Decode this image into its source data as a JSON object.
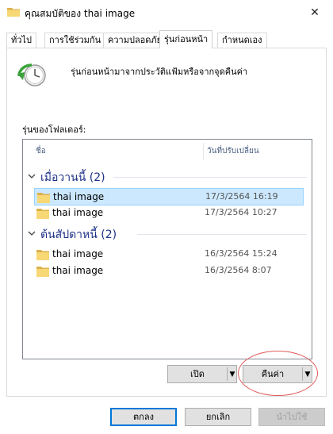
{
  "window": {
    "title": "คุณสมบัติของ thai image",
    "close_glyph": "✕"
  },
  "tabs": [
    {
      "label": "ทั่วไป",
      "active": false
    },
    {
      "label": "การใช้ร่วมกัน",
      "active": false
    },
    {
      "label": "ความปลอดภัย",
      "active": false
    },
    {
      "label": "รุ่นก่อนหน้า",
      "active": true
    },
    {
      "label": "กำหนดเอง",
      "active": false
    }
  ],
  "page": {
    "description": "รุ่นก่อนหน้ามาจากประวัติแฟ้มหรือจากจุดคืนค่า",
    "versions_label": "รุ่นของโฟลเดอร์:",
    "columns": {
      "name": "ชื่อ",
      "date": "วันที่ปรับเปลี่ยน"
    },
    "groups": [
      {
        "title": "เมื่อวานนี้ (2)",
        "rows": [
          {
            "name": "thai image",
            "date": "17/3/2564 16:19",
            "selected": true
          },
          {
            "name": "thai image",
            "date": "17/3/2564 10:27",
            "selected": false
          }
        ]
      },
      {
        "title": "ต้นสัปดาหนี้ (2)",
        "rows": [
          {
            "name": "thai image",
            "date": "16/3/2564 15:24",
            "selected": false
          },
          {
            "name": "thai image",
            "date": "16/3/2564 8:07",
            "selected": false
          }
        ]
      }
    ],
    "open_button": "เปิด",
    "restore_button": "คืนค่า"
  },
  "buttons": {
    "ok": "ตกลง",
    "cancel": "ยกเลิก",
    "apply": "นำไปใช้"
  },
  "colors": {
    "selection": "#cce8ff",
    "group_title": "#1e3287",
    "folder": "#f8d775",
    "highlight": "#e05a5a"
  },
  "icons": {
    "title": "folder-icon",
    "page": "restore-clock-icon",
    "row": "folder-icon",
    "group": "chevron-down-icon",
    "split": "dropdown-arrow-icon"
  }
}
